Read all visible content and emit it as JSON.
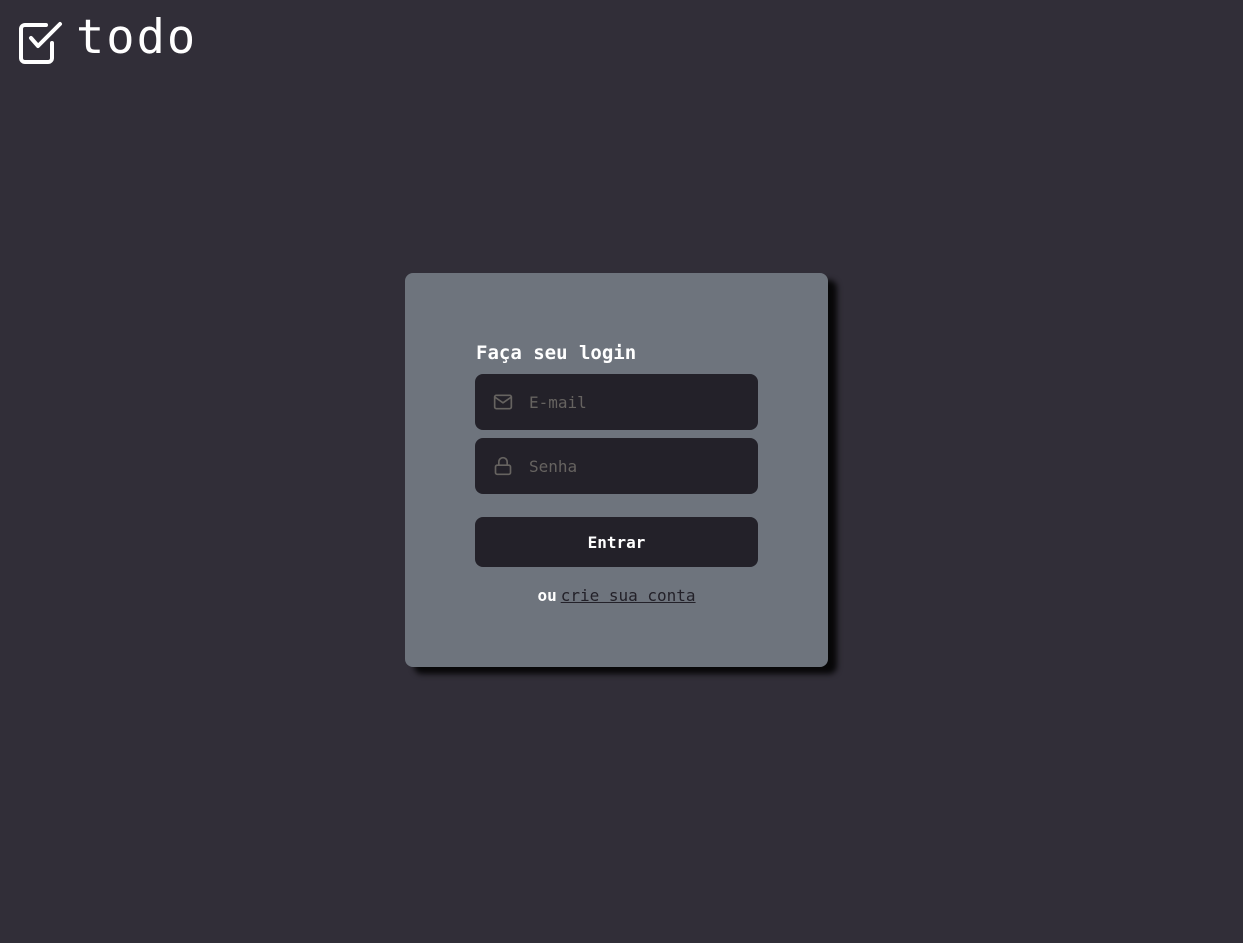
{
  "header": {
    "logo_icon": "checkbox-checked-icon",
    "logo_text": "todo"
  },
  "login": {
    "title": "Faça seu login",
    "email": {
      "icon": "mail-icon",
      "placeholder": "E-mail",
      "value": ""
    },
    "password": {
      "icon": "lock-icon",
      "placeholder": "Senha",
      "value": ""
    },
    "submit_label": "Entrar",
    "alt_prefix": "ou",
    "signup_link": "crie sua conta"
  },
  "colors": {
    "background": "#312e38",
    "card": "#6e747d",
    "input_bg": "#232129",
    "placeholder": "#666360",
    "text": "#ffffff"
  }
}
